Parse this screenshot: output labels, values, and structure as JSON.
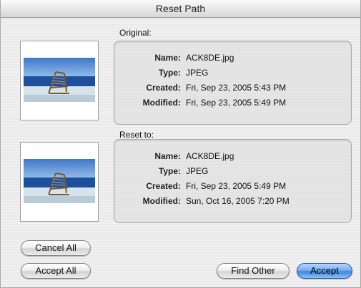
{
  "window": {
    "title": "Reset Path"
  },
  "original": {
    "heading": "Original:",
    "fields": [
      {
        "label": "Name:",
        "value": "ACK8DE.jpg"
      },
      {
        "label": "Type:",
        "value": "JPEG"
      },
      {
        "label": "Created:",
        "value": "Fri, Sep 23, 2005 5:43 PM"
      },
      {
        "label": "Modified:",
        "value": "Fri, Sep 23, 2005 5:49 PM"
      }
    ]
  },
  "reset_to": {
    "heading": "Reset to:",
    "fields": [
      {
        "label": "Name:",
        "value": "ACK8DE.jpg"
      },
      {
        "label": "Type:",
        "value": "JPEG"
      },
      {
        "label": "Created:",
        "value": "Fri, Sep 23, 2005 5:49 PM"
      },
      {
        "label": "Modified:",
        "value": "Sun, Oct 16, 2005 7:20 PM"
      }
    ]
  },
  "buttons": {
    "cancel_all": "Cancel All",
    "accept_all": "Accept All",
    "find_other": "Find Other",
    "accept": "Accept"
  }
}
